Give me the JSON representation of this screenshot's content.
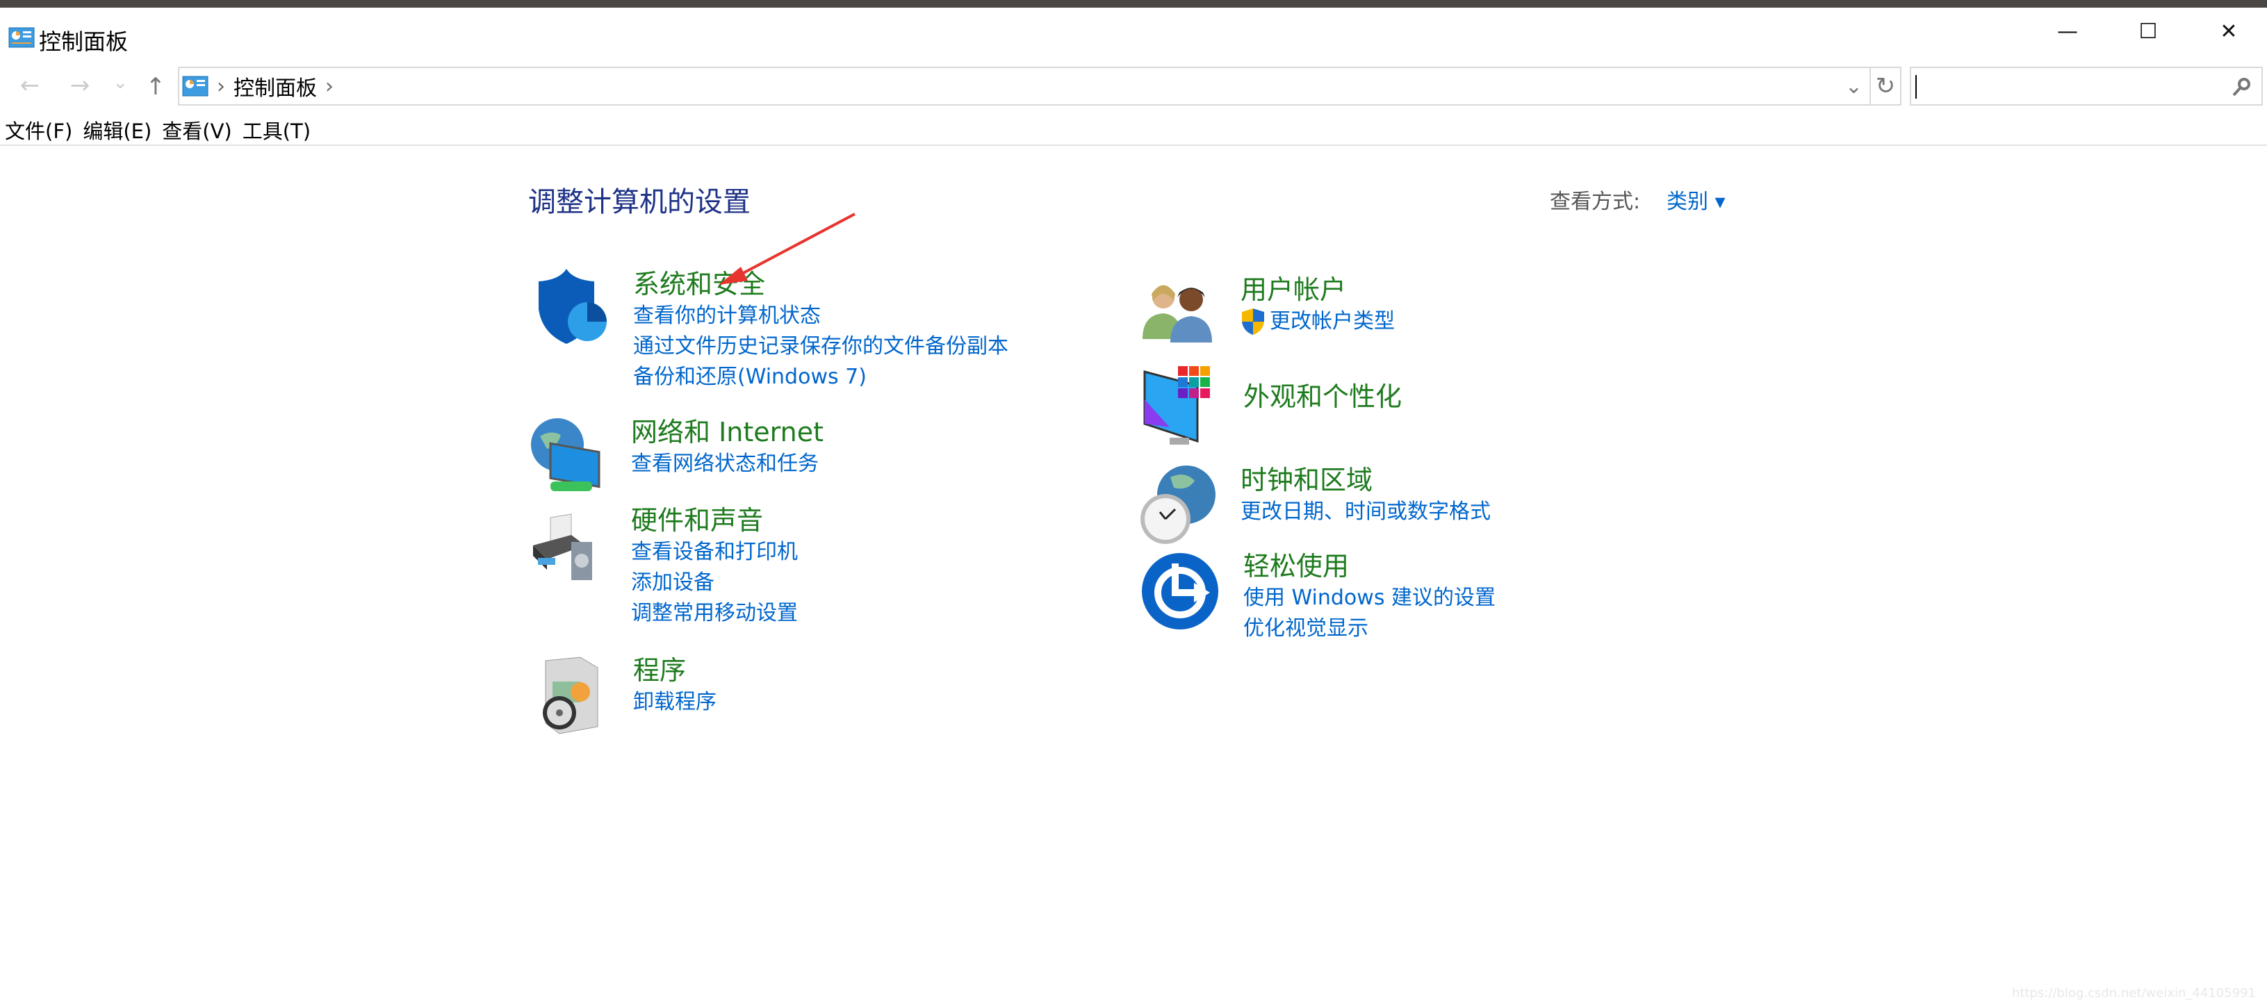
{
  "window": {
    "title": "控制面板",
    "minimize": "—",
    "maximize": "☐",
    "close": "✕"
  },
  "nav": {
    "back": "←",
    "forward": "→",
    "recent": "⌄",
    "up": "↑",
    "breadcrumb": [
      "控制面板"
    ],
    "sep": "›",
    "dropdown": "⌄",
    "refresh": "↻",
    "search_placeholder": "",
    "search_icon": "⚲"
  },
  "menu": [
    "文件(F)",
    "编辑(E)",
    "查看(V)",
    "工具(T)"
  ],
  "main": {
    "heading": "调整计算机的设置",
    "view_by_label": "查看方式:",
    "view_by_value": "类别 ▾",
    "categories": [
      {
        "title": "系统和安全",
        "icon": "shield-icon",
        "links": [
          "查看你的计算机状态",
          "通过文件历史记录保存你的文件备份副本",
          "备份和还原(Windows 7)"
        ]
      },
      {
        "title": "网络和 Internet",
        "icon": "network-icon",
        "links": [
          "查看网络状态和任务"
        ]
      },
      {
        "title": "硬件和声音",
        "icon": "printer-icon",
        "links": [
          "查看设备和打印机",
          "添加设备",
          "调整常用移动设置"
        ]
      },
      {
        "title": "程序",
        "icon": "programs-icon",
        "links": [
          "卸载程序"
        ]
      },
      {
        "title": "用户帐户",
        "icon": "users-icon",
        "links": [
          "更改帐户类型"
        ]
      },
      {
        "title": "外观和个性化",
        "icon": "appearance-icon",
        "links": []
      },
      {
        "title": "时钟和区域",
        "icon": "clock-globe-icon",
        "links": [
          "更改日期、时间或数字格式"
        ]
      },
      {
        "title": "轻松使用",
        "icon": "ease-of-access-icon",
        "links": [
          "使用 Windows 建议的设置",
          "优化视觉显示"
        ]
      }
    ]
  },
  "watermark": "https://blog.csdn.net/weixin_44105991",
  "colors": {
    "category_title": "#1e7b1e",
    "link": "#0066cc",
    "heading": "#1e3287",
    "annotation_arrow": "#e8342e"
  }
}
